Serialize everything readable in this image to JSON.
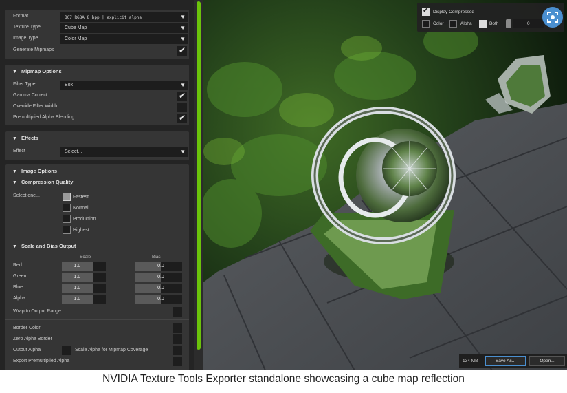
{
  "main_options": {
    "format_label": "Format",
    "format_value": "BC7       RGBA  8 bpp | explicit alpha",
    "texture_type_label": "Texture Type",
    "texture_type_value": "Cube Map",
    "image_type_label": "Image Type",
    "image_type_value": "Color Map",
    "generate_mipmaps_label": "Generate Mipmaps",
    "generate_mipmaps": true
  },
  "mipmap_options": {
    "title": "Mipmap Options",
    "filter_type_label": "Filter Type",
    "filter_type_value": "Box",
    "gamma_correct_label": "Gamma Correct",
    "gamma_correct": true,
    "override_filter_width_label": "Override Filter Width",
    "override_filter_width": false,
    "premultiplied_alpha_label": "Premultiplied Alpha Blending",
    "premultiplied_alpha": true
  },
  "effects": {
    "title": "Effects",
    "effect_label": "Effect",
    "effect_value": "Select..."
  },
  "image_options": {
    "title": "Image Options",
    "compression_quality_title": "Compression Quality",
    "select_label": "Select one...",
    "quality_options": [
      "Fastest",
      "Normal",
      "Production",
      "Highest"
    ],
    "quality_selected": "Fastest",
    "scale_bias_title": "Scale and Bias Output",
    "scale_header": "Scale",
    "bias_header": "Bias",
    "channels": [
      {
        "label": "Red",
        "scale": "1.0",
        "bias": "0.0"
      },
      {
        "label": "Green",
        "scale": "1.0",
        "bias": "0.0"
      },
      {
        "label": "Blue",
        "scale": "1.0",
        "bias": "0.0"
      },
      {
        "label": "Alpha",
        "scale": "1.0",
        "bias": "0.0"
      }
    ],
    "wrap_label": "Wrap to Output Range",
    "border_color_label": "Border Color",
    "zero_alpha_border_label": "Zero Alpha Border",
    "cutout_alpha_label": "Cutout Alpha",
    "scale_alpha_mipmap_label": "Scale Alpha for Mipmap Coverage",
    "export_premultiplied_label": "Export Premultiplied Alpha"
  },
  "viewport_overlay": {
    "display_compressed_label": "Display Compressed",
    "display_compressed": true,
    "color_label": "Color",
    "alpha_label": "Alpha",
    "both_label": "Both",
    "both_selected": true,
    "mip_value": "0"
  },
  "bottom_bar": {
    "memory": "134 MB",
    "save_as": "Save As...",
    "open": "Open..."
  },
  "caption": "NVIDIA Texture Tools Exporter standalone showcasing a cube map reflection",
  "colors": {
    "accent_scrollbar": "#6bc30b",
    "zoom_button": "#4a8fd0",
    "panel_bg": "#353535"
  }
}
